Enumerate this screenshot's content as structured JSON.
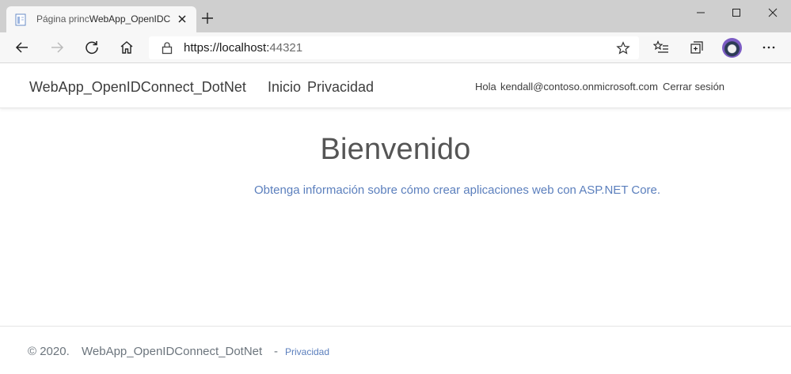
{
  "browser": {
    "tab": {
      "title_part1": "Página princ",
      "title_part2": "WebApp_OpenIDC"
    },
    "address": {
      "url_main": "https://localhost:",
      "url_port": "44321"
    }
  },
  "site": {
    "brand": "WebApp_OpenIDConnect_DotNet",
    "nav": {
      "home": "Inicio",
      "privacy": "Privacidad",
      "greeting": "Hola",
      "user": "kendall@contoso.onmicrosoft.com",
      "signout": "Cerrar sesión"
    },
    "main": {
      "heading": "Bienvenido",
      "learn_prefix": "Obtenga ",
      "learn_link": "información sobre cómo crear aplicaciones web con ASP.NET Core",
      "learn_suffix": "."
    },
    "footer": {
      "copyright": "© 2020.",
      "app": "WebApp_OpenIDConnect_DotNet",
      "dash": "-",
      "privacy": "Privacidad"
    }
  },
  "colors": {
    "link": "#5b7fbd",
    "titlebar": "#cfcfcf",
    "toolbar": "#f7f7f7"
  }
}
